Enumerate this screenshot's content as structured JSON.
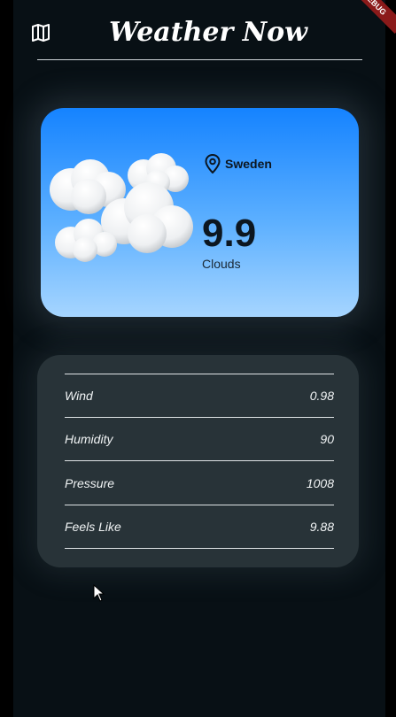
{
  "app": {
    "title": "Weather Now",
    "debug_banner": "DEBUG"
  },
  "weather": {
    "location": "Sweden",
    "temperature": "9.9",
    "condition": "Clouds"
  },
  "details": [
    {
      "label": "Wind",
      "value": "0.98"
    },
    {
      "label": "Humidity",
      "value": "90"
    },
    {
      "label": "Pressure",
      "value": "1008"
    },
    {
      "label": "Feels Like",
      "value": "9.88"
    }
  ],
  "colors": {
    "background": "#081015",
    "card_gradient_top": "#1583ff",
    "card_gradient_bottom": "#a6d5ff",
    "details_card": "#283338",
    "text_light": "#f1f4f5"
  },
  "icons": {
    "header_left": "map-icon",
    "location": "location-pin-icon",
    "weather": "clouds-icon"
  }
}
